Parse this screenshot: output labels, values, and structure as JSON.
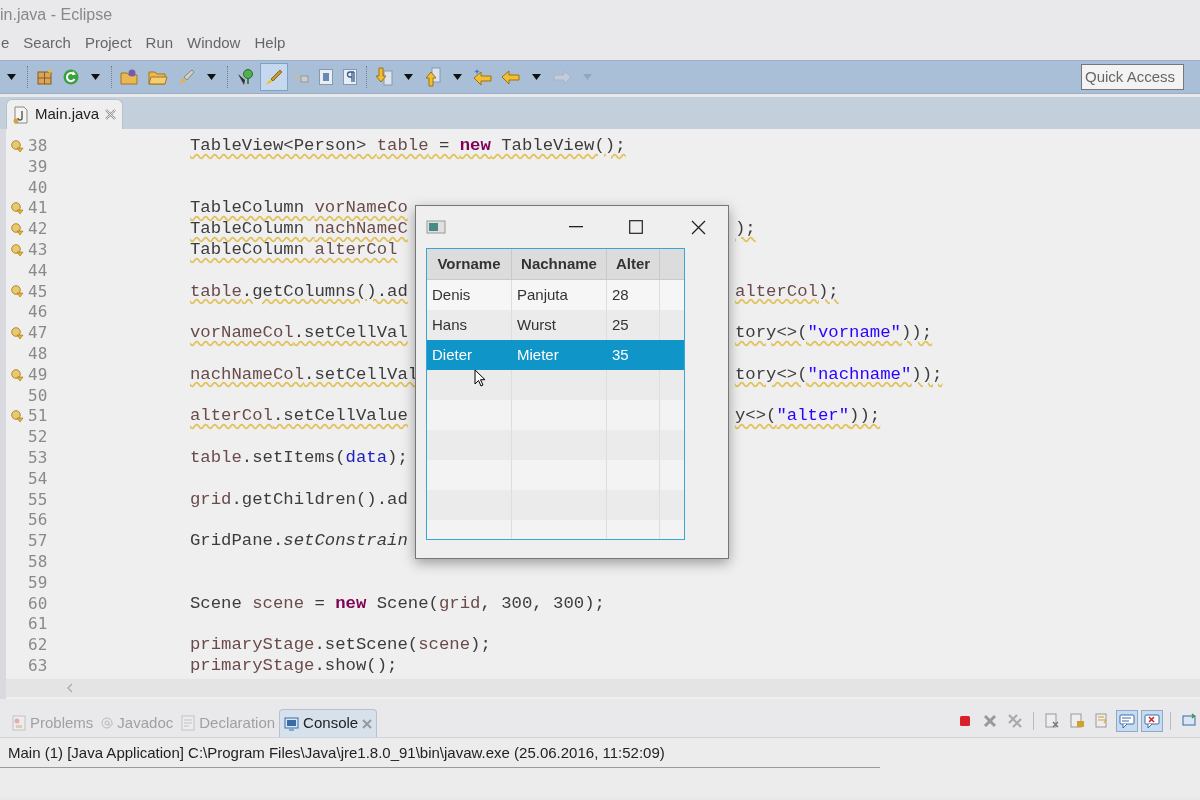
{
  "window": {
    "title": "in.java - Eclipse"
  },
  "menu": [
    "e",
    "Search",
    "Project",
    "Run",
    "Window",
    "Help"
  ],
  "toolbar": {
    "items": [
      {
        "kind": "caret",
        "disabled": false
      },
      {
        "kind": "separator"
      },
      {
        "kind": "package",
        "disabled": false
      },
      {
        "kind": "refresh",
        "disabled": false
      },
      {
        "kind": "caret",
        "disabled": false
      },
      {
        "kind": "separator"
      },
      {
        "kind": "folder-plus",
        "disabled": false
      },
      {
        "kind": "folder",
        "disabled": false
      },
      {
        "kind": "brush",
        "disabled": false
      },
      {
        "kind": "caret",
        "disabled": false
      },
      {
        "kind": "separator"
      },
      {
        "kind": "pin",
        "disabled": false
      },
      {
        "kind": "highlighter",
        "pressed": true,
        "disabled": false
      },
      {
        "kind": "shapes",
        "disabled": false
      },
      {
        "kind": "doc-box",
        "disabled": false
      },
      {
        "kind": "pilcrow",
        "disabled": false
      },
      {
        "kind": "separator"
      },
      {
        "kind": "arrow-down",
        "disabled": false
      },
      {
        "kind": "caret",
        "disabled": false
      },
      {
        "kind": "arrow-up",
        "disabled": false
      },
      {
        "kind": "caret",
        "disabled": false
      },
      {
        "kind": "back-star",
        "disabled": false
      },
      {
        "kind": "back",
        "disabled": false
      },
      {
        "kind": "caret",
        "disabled": false
      },
      {
        "kind": "forward",
        "disabled": true
      },
      {
        "kind": "caret",
        "disabled": true
      }
    ],
    "quick_access": {
      "placeholder": "Quick Access"
    }
  },
  "editor_tabs": [
    {
      "label": "Main.java",
      "selected": true
    }
  ],
  "code_lines": [
    {
      "number": "38",
      "warning": true,
      "left": [
        {
          "text": "TableView<Person> ",
          "kind": "plain"
        },
        {
          "text": "table",
          "kind": "variable"
        },
        {
          "text": " = ",
          "kind": "plain"
        },
        {
          "text": "new",
          "kind": "keyword"
        },
        {
          "text": " TableView();",
          "kind": "plain"
        }
      ]
    },
    {
      "number": "39",
      "warning": false
    },
    {
      "number": "40",
      "warning": false
    },
    {
      "number": "41",
      "warning": true,
      "left": [
        {
          "text": "TableColumn ",
          "kind": "plain"
        },
        {
          "text": "vorNameCo",
          "kind": "variable"
        }
      ]
    },
    {
      "number": "42",
      "warning": true,
      "left": [
        {
          "text": "TableColumn ",
          "kind": "plain"
        },
        {
          "text": "nachNameC",
          "kind": "variable"
        }
      ],
      "right": [
        {
          "text": ");",
          "kind": "plain"
        }
      ]
    },
    {
      "number": "43",
      "warning": true,
      "left": [
        {
          "text": "TableColumn ",
          "kind": "plain"
        },
        {
          "text": "alterCol",
          "kind": "variable"
        }
      ]
    },
    {
      "number": "44",
      "warning": false
    },
    {
      "number": "45",
      "warning": true,
      "left": [
        {
          "text": "table",
          "kind": "variable"
        },
        {
          "text": ".getColumns().ad",
          "kind": "plain"
        }
      ],
      "right": [
        {
          "text": "alterCol",
          "kind": "variable"
        },
        {
          "text": ");",
          "kind": "plain"
        }
      ]
    },
    {
      "number": "46",
      "warning": false
    },
    {
      "number": "47",
      "warning": true,
      "left": [
        {
          "text": "vorNameCol",
          "kind": "variable"
        },
        {
          "text": ".setCellVal",
          "kind": "plain"
        }
      ],
      "right": [
        {
          "text": "tory<>(",
          "kind": "plain"
        },
        {
          "text": "\"vorname\"",
          "kind": "string"
        },
        {
          "text": "));",
          "kind": "plain"
        }
      ]
    },
    {
      "number": "48",
      "warning": false
    },
    {
      "number": "49",
      "warning": true,
      "left": [
        {
          "text": "nachNameCol",
          "kind": "variable"
        },
        {
          "text": ".setCellVal",
          "kind": "plain"
        }
      ],
      "right": [
        {
          "text": "tory<>(",
          "kind": "plain"
        },
        {
          "text": "\"nachname\"",
          "kind": "string"
        },
        {
          "text": "));",
          "kind": "plain"
        }
      ]
    },
    {
      "number": "50",
      "warning": false
    },
    {
      "number": "51",
      "warning": true,
      "left": [
        {
          "text": "alterCol",
          "kind": "variable"
        },
        {
          "text": ".setCellValue",
          "kind": "plain"
        }
      ],
      "right": [
        {
          "text": "y<>(",
          "kind": "plain"
        },
        {
          "text": "\"alter\"",
          "kind": "string"
        },
        {
          "text": "));",
          "kind": "plain"
        }
      ]
    },
    {
      "number": "52",
      "warning": false
    },
    {
      "number": "53",
      "warning": false,
      "left": [
        {
          "text": "table",
          "kind": "variable"
        },
        {
          "text": ".setItems(",
          "kind": "plain"
        },
        {
          "text": "data",
          "kind": "field"
        },
        {
          "text": ");",
          "kind": "plain"
        }
      ]
    },
    {
      "number": "54",
      "warning": false
    },
    {
      "number": "55",
      "warning": false,
      "left": [
        {
          "text": "grid",
          "kind": "variable"
        },
        {
          "text": ".getChildren().ad",
          "kind": "plain"
        }
      ]
    },
    {
      "number": "56",
      "warning": false
    },
    {
      "number": "57",
      "warning": false,
      "left": [
        {
          "text": "GridPane.",
          "kind": "plain"
        },
        {
          "text": "setConstrain",
          "kind": "italic"
        }
      ]
    },
    {
      "number": "58",
      "warning": false
    },
    {
      "number": "59",
      "warning": false
    },
    {
      "number": "60",
      "warning": false,
      "left": [
        {
          "text": "Scene ",
          "kind": "plain"
        },
        {
          "text": "scene",
          "kind": "variable"
        },
        {
          "text": " = ",
          "kind": "plain"
        },
        {
          "text": "new",
          "kind": "keyword"
        },
        {
          "text": " Scene(",
          "kind": "plain"
        },
        {
          "text": "grid",
          "kind": "variable"
        },
        {
          "text": ", 300, 300);",
          "kind": "plain"
        }
      ]
    },
    {
      "number": "61",
      "warning": false
    },
    {
      "number": "62",
      "warning": false,
      "left": [
        {
          "text": "primaryStage",
          "kind": "variable"
        },
        {
          "text": ".setScene(",
          "kind": "plain"
        },
        {
          "text": "scene",
          "kind": "variable"
        },
        {
          "text": ");",
          "kind": "plain"
        }
      ]
    },
    {
      "number": "63",
      "warning": false,
      "left": [
        {
          "text": "primaryStage",
          "kind": "variable"
        },
        {
          "text": ".show();",
          "kind": "plain"
        }
      ]
    }
  ],
  "app_window": {
    "table": {
      "columns": [
        "Vorname",
        "Nachname",
        "Alter"
      ],
      "rows": [
        {
          "cells": [
            "Denis",
            "Panjuta",
            "28"
          ],
          "selected": false
        },
        {
          "cells": [
            "Hans",
            "Wurst",
            "25"
          ],
          "selected": false
        },
        {
          "cells": [
            "Dieter",
            "Mieter",
            "35"
          ],
          "selected": true
        }
      ]
    }
  },
  "bottom_tabs": [
    {
      "label": "Problems",
      "kind": "problems",
      "selected": false
    },
    {
      "label": "Javadoc",
      "kind": "javadoc",
      "selected": false
    },
    {
      "label": "Declaration",
      "kind": "declaration",
      "selected": false
    },
    {
      "label": "Console",
      "kind": "console",
      "selected": true
    }
  ],
  "console_toolbar": [
    {
      "kind": "stop",
      "pressed": false
    },
    {
      "kind": "remove",
      "pressed": false
    },
    {
      "kind": "remove-all",
      "pressed": false
    },
    {
      "kind": "separator"
    },
    {
      "kind": "clear",
      "pressed": false
    },
    {
      "kind": "scroll-lock",
      "pressed": false
    },
    {
      "kind": "word-wrap",
      "pressed": false
    },
    {
      "kind": "show-out",
      "pressed": true
    },
    {
      "kind": "show-err",
      "pressed": true
    },
    {
      "kind": "separator"
    },
    {
      "kind": "open-console",
      "pressed": false
    }
  ],
  "console": {
    "header": "Main (1) [Java Application] C:\\Program Files\\Java\\jre1.8.0_91\\bin\\javaw.exe (25.06.2016, 11:52:09)"
  }
}
